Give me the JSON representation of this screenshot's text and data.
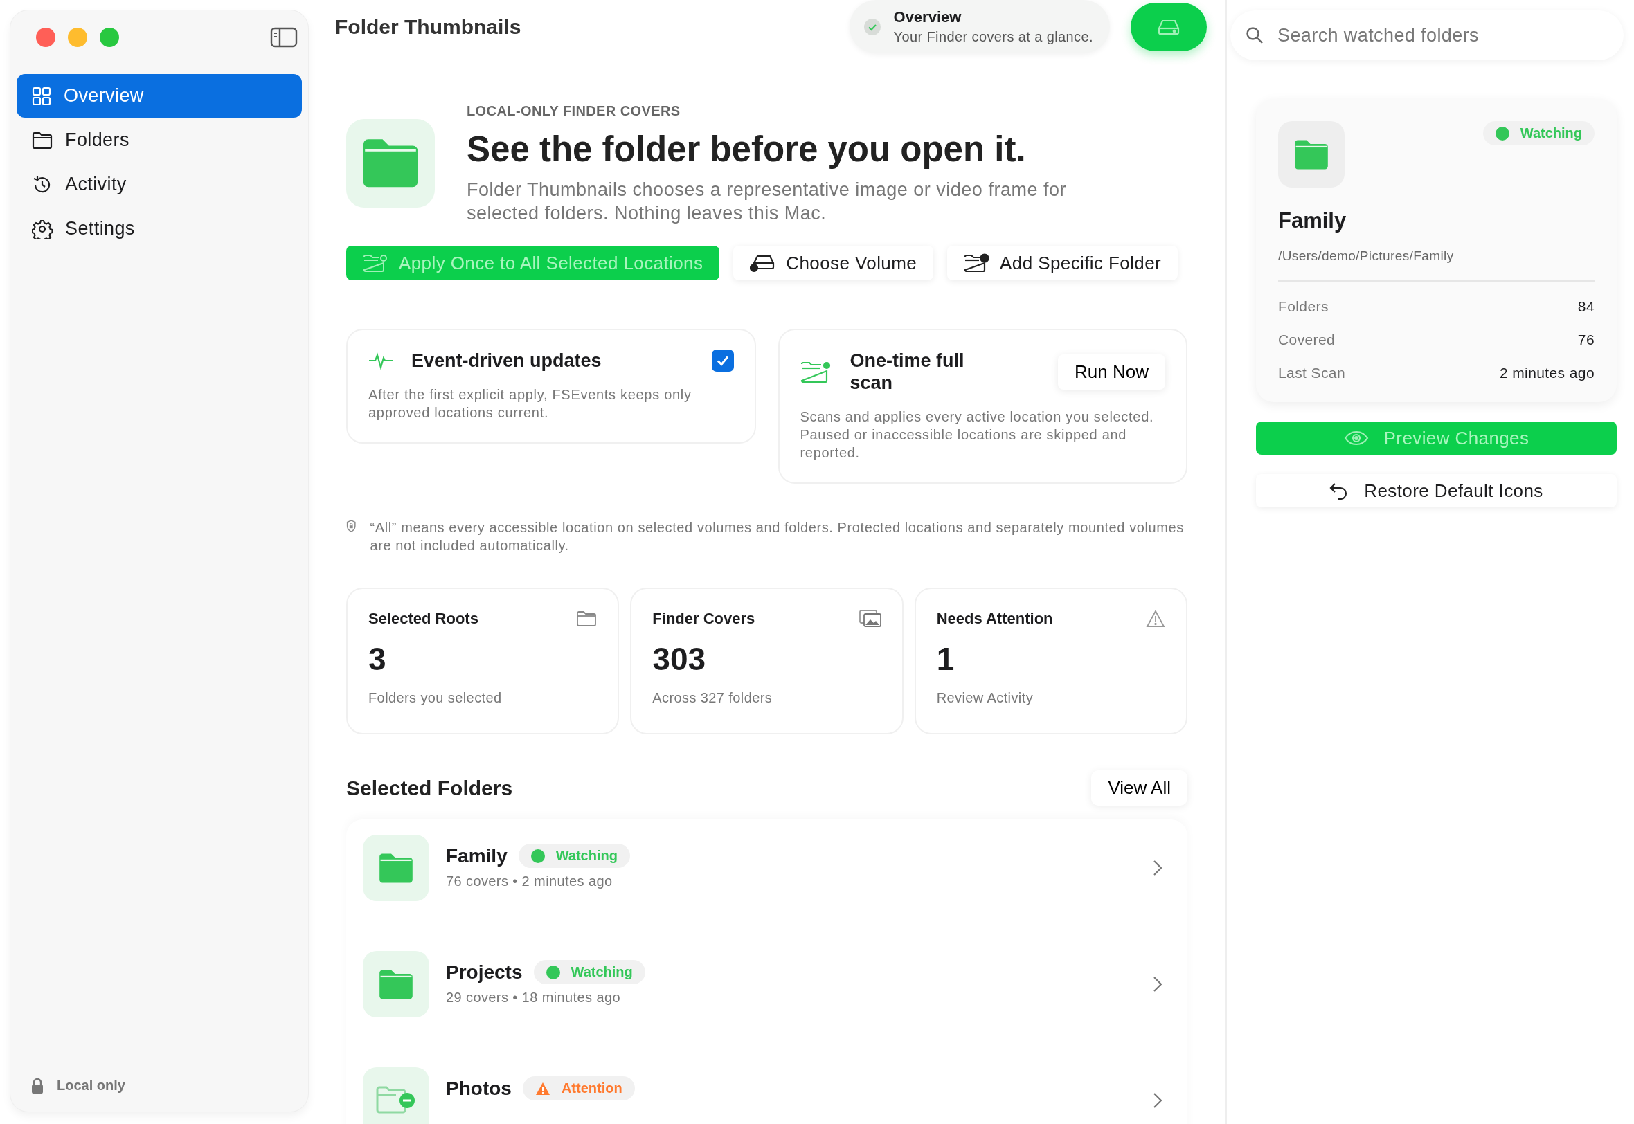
{
  "window": {
    "title": "Folder Thumbnails"
  },
  "sidebar": {
    "items": [
      {
        "label": "Overview",
        "selected": true
      },
      {
        "label": "Folders",
        "selected": false
      },
      {
        "label": "Activity",
        "selected": false
      },
      {
        "label": "Settings",
        "selected": false
      }
    ],
    "footer": "Local only"
  },
  "toast": {
    "title": "Overview",
    "subtitle": "Your Finder covers at a glance."
  },
  "hero": {
    "eyebrow": "LOCAL-ONLY FINDER COVERS",
    "heading": "See the folder before you open it.",
    "description": "Folder Thumbnails chooses a representative image or video frame for selected folders. Nothing leaves this Mac."
  },
  "actions": [
    {
      "label": "Apply Once to All Selected Locations",
      "kind": "primary"
    },
    {
      "label": "Choose Volume",
      "kind": "volume"
    },
    {
      "label": "Add Specific Folder",
      "kind": "folder"
    }
  ],
  "options": [
    {
      "kind": "toggle",
      "title": "Event-driven updates",
      "description": "After the first explicit apply, FSEvents keeps only approved locations current.",
      "checked": true
    },
    {
      "kind": "action",
      "title": "One-time full scan",
      "description": "Scans and applies every active location you selected. Paused or inaccessible locations are skipped and reported.",
      "button": "Run Now"
    }
  ],
  "note": "“All” means every accessible location on selected volumes and folders. Protected locations and separately mounted volumes are not included automatically.",
  "stats": [
    {
      "title": "Selected Roots",
      "value": "3",
      "caption": "Folders you selected"
    },
    {
      "title": "Finder Covers",
      "value": "303",
      "caption": "Across 327 folders"
    },
    {
      "title": "Needs Attention",
      "value": "1",
      "caption": "Review Activity"
    }
  ],
  "selected_folders": {
    "title": "Selected Folders",
    "view_all": "View All",
    "rows": [
      {
        "name": "Family",
        "status": {
          "label": "Watching",
          "kind": "watching"
        },
        "subtitle": "76 covers • 2 minutes ago"
      },
      {
        "name": "Projects",
        "status": {
          "label": "Watching",
          "kind": "watching"
        },
        "subtitle": "29 covers • 18 minutes ago"
      },
      {
        "name": "Photos",
        "status": {
          "label": "Attention",
          "kind": "attention"
        }
      }
    ]
  },
  "search": {
    "placeholder": "Search watched folders"
  },
  "detail": {
    "status": {
      "label": "Watching",
      "kind": "watching"
    },
    "name": "Family",
    "path": "/Users/demo/Pictures/Family",
    "facts": [
      {
        "label": "Folders",
        "value": "84"
      },
      {
        "label": "Covered",
        "value": "76"
      },
      {
        "label": "Last Scan",
        "value": "2 minutes ago"
      }
    ]
  },
  "detail_actions": [
    {
      "label": "Preview Changes",
      "kind": "primary"
    },
    {
      "label": "Restore Default Icons",
      "kind": "secondary"
    }
  ]
}
